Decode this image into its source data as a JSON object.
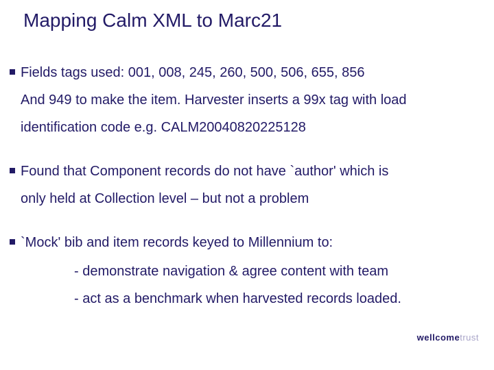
{
  "title": "Mapping Calm XML to Marc21",
  "bullets": [
    {
      "lead": "Fields tags used: 001, 008, 245, 260, 500, 506, 655, 856",
      "cont1": "And 949 to make the item.  Harvester inserts a 99x tag with load",
      "cont2": "identification code e.g. CALM20040820225128"
    },
    {
      "lead": "Found that Component records do not have `author' which is",
      "cont1": "only held at Collection level – but not a problem"
    },
    {
      "lead": "`Mock' bib and item records keyed to Millennium to:",
      "subs": [
        "- demonstrate navigation & agree content with team",
        "- act as a benchmark when harvested records loaded."
      ]
    }
  ],
  "footer": {
    "bold": "wellcome",
    "light": "trust"
  }
}
